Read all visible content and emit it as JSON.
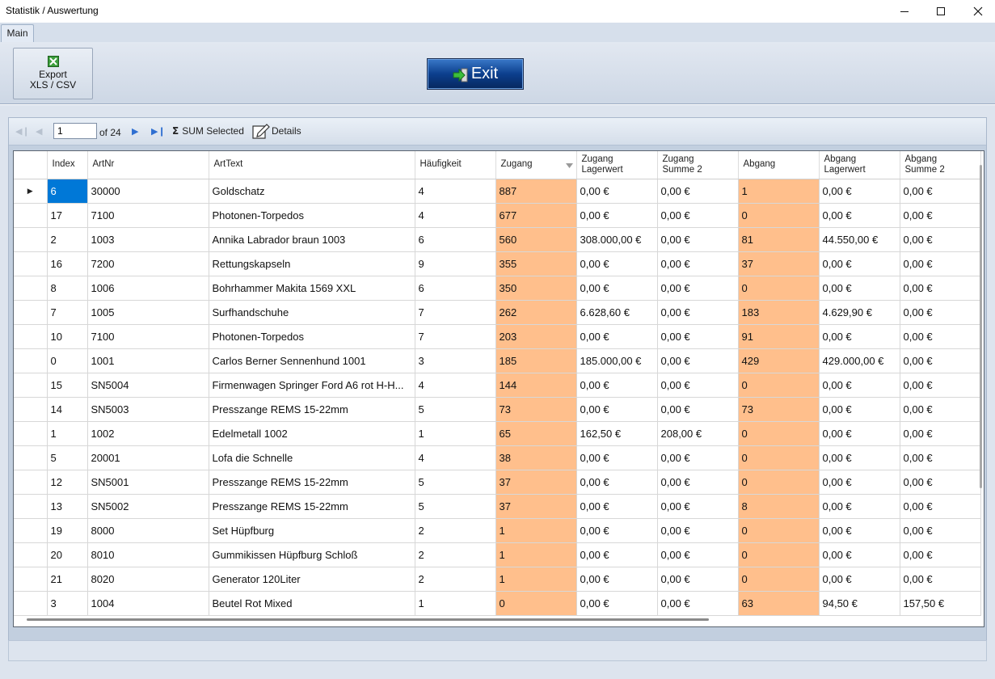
{
  "window": {
    "title": "Statistik / Auswertung"
  },
  "ribbon": {
    "tab_main": "Main",
    "export_label_1": "Export",
    "export_label_2": "XLS / CSV",
    "exit_label": "Exit"
  },
  "navigator": {
    "page": "1",
    "of_label": "of 24",
    "sum_label": "SUM Selected",
    "details_label": "Details"
  },
  "columns": {
    "index": "Index",
    "artnr": "ArtNr",
    "arttext": "ArtText",
    "haeufigkeit": "Häufigkeit",
    "zugang": "Zugang",
    "zugang_lagerwert_1": "Zugang",
    "zugang_lagerwert_2": "Lagerwert",
    "zugang_summe2_1": "Zugang",
    "zugang_summe2_2": "Summe 2",
    "abgang": "Abgang",
    "abgang_lagerwert_1": "Abgang",
    "abgang_lagerwert_2": "Lagerwert",
    "abgang_summe2_1": "Abgang",
    "abgang_summe2_2": "Summe 2"
  },
  "rows": [
    [
      "6",
      "30000",
      "Goldschatz",
      "4",
      "887",
      "0,00 €",
      "0,00 €",
      "1",
      "0,00 €",
      "0,00 €"
    ],
    [
      "17",
      "7100",
      "Photonen-Torpedos",
      "4",
      "677",
      "0,00 €",
      "0,00 €",
      "0",
      "0,00 €",
      "0,00 €"
    ],
    [
      "2",
      "1003",
      "Annika Labrador braun 1003",
      "6",
      "560",
      "308.000,00 €",
      "0,00 €",
      "81",
      "44.550,00 €",
      "0,00 €"
    ],
    [
      "16",
      "7200",
      "Rettungskapseln",
      "9",
      "355",
      "0,00 €",
      "0,00 €",
      "37",
      "0,00 €",
      "0,00 €"
    ],
    [
      "8",
      "1006",
      "Bohrhammer Makita 1569 XXL",
      "6",
      "350",
      "0,00 €",
      "0,00 €",
      "0",
      "0,00 €",
      "0,00 €"
    ],
    [
      "7",
      "1005",
      "Surfhandschuhe",
      "7",
      "262",
      "6.628,60 €",
      "0,00 €",
      "183",
      "4.629,90 €",
      "0,00 €"
    ],
    [
      "10",
      "7100",
      "Photonen-Torpedos",
      "7",
      "203",
      "0,00 €",
      "0,00 €",
      "91",
      "0,00 €",
      "0,00 €"
    ],
    [
      "0",
      "1001",
      "Carlos Berner Sennenhund 1001",
      "3",
      "185",
      "185.000,00 €",
      "0,00 €",
      "429",
      "429.000,00 €",
      "0,00 €"
    ],
    [
      "15",
      "SN5004",
      "Firmenwagen Springer Ford A6 rot H-H...",
      "4",
      "144",
      "0,00 €",
      "0,00 €",
      "0",
      "0,00 €",
      "0,00 €"
    ],
    [
      "14",
      "SN5003",
      "Presszange REMS 15-22mm",
      "5",
      "73",
      "0,00 €",
      "0,00 €",
      "73",
      "0,00 €",
      "0,00 €"
    ],
    [
      "1",
      "1002",
      "Edelmetall 1002",
      "1",
      "65",
      "162,50 €",
      "208,00 €",
      "0",
      "0,00 €",
      "0,00 €"
    ],
    [
      "5",
      "20001",
      "Lofa die Schnelle",
      "4",
      "38",
      "0,00 €",
      "0,00 €",
      "0",
      "0,00 €",
      "0,00 €"
    ],
    [
      "12",
      "SN5001",
      "Presszange REMS 15-22mm",
      "5",
      "37",
      "0,00 €",
      "0,00 €",
      "0",
      "0,00 €",
      "0,00 €"
    ],
    [
      "13",
      "SN5002",
      "Presszange REMS 15-22mm",
      "5",
      "37",
      "0,00 €",
      "0,00 €",
      "8",
      "0,00 €",
      "0,00 €"
    ],
    [
      "19",
      "8000",
      "Set Hüpfburg",
      "2",
      "1",
      "0,00 €",
      "0,00 €",
      "0",
      "0,00 €",
      "0,00 €"
    ],
    [
      "20",
      "8010",
      "Gummikissen Hüpfburg Schloß",
      "2",
      "1",
      "0,00 €",
      "0,00 €",
      "0",
      "0,00 €",
      "0,00 €"
    ],
    [
      "21",
      "8020",
      "Generator 120Liter",
      "2",
      "1",
      "0,00 €",
      "0,00 €",
      "0",
      "0,00 €",
      "0,00 €"
    ],
    [
      "3",
      "1004",
      "Beutel Rot Mixed",
      "1",
      "0",
      "0,00 €",
      "0,00 €",
      "63",
      "94,50 €",
      "157,50 €"
    ]
  ],
  "colors": {
    "highlight_column": "#ffbf8c",
    "selection": "#0078d7",
    "exit_button": "#0c3f8d"
  }
}
